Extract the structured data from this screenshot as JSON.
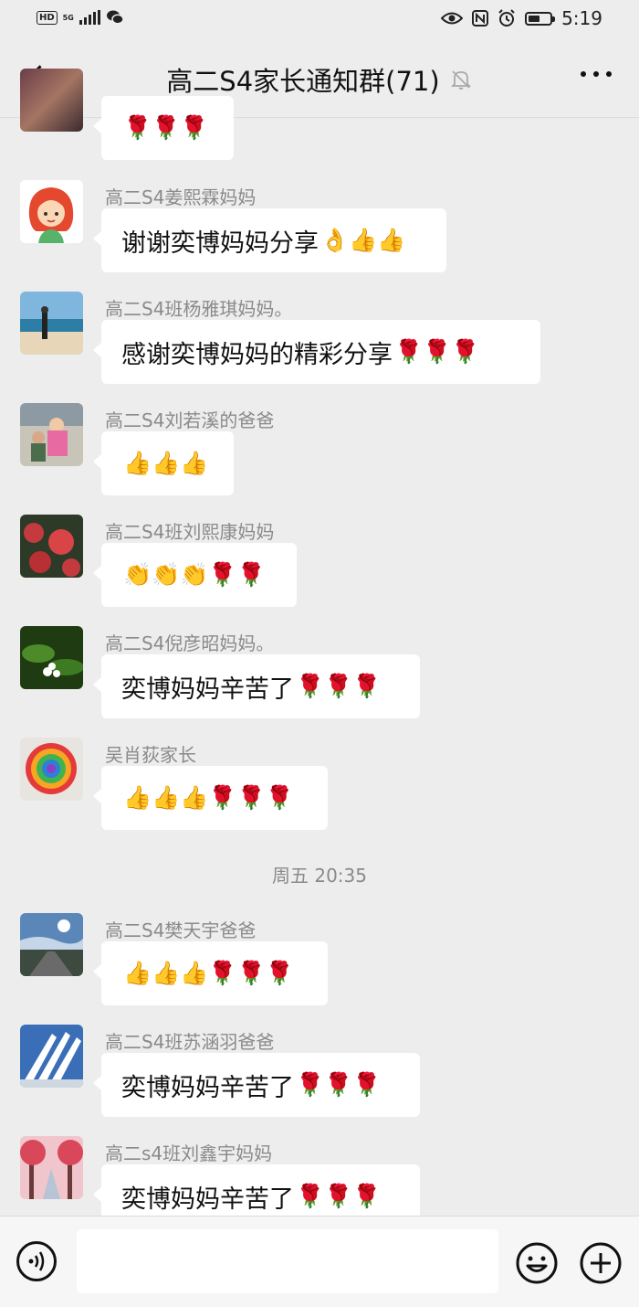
{
  "status_bar": {
    "hd": "HD",
    "network": "5G",
    "time": "5:19"
  },
  "header": {
    "title": "高二S4家长通知群(71)",
    "muted_icon": "bell-off-icon",
    "more_icon": "more-dots-icon"
  },
  "messages": [
    {
      "sender": "",
      "text": "",
      "emoji": "🌹🌹🌹"
    },
    {
      "sender": "高二S4姜熙霖妈妈",
      "text": "谢谢奕博妈妈分享",
      "emoji": "👌👍👍"
    },
    {
      "sender": "高二S4班杨雅琪妈妈。",
      "text": "感谢奕博妈妈的精彩分享",
      "emoji": "🌹🌹🌹"
    },
    {
      "sender": "高二S4刘若溪的爸爸",
      "text": "",
      "emoji": "👍👍👍"
    },
    {
      "sender": "高二S4班刘熙康妈妈",
      "text": "",
      "emoji": "👏👏👏🌹🌹"
    },
    {
      "sender": "高二S4倪彦昭妈妈。",
      "text": "奕博妈妈辛苦了",
      "emoji": "🌹🌹🌹"
    },
    {
      "sender": "吴肖荻家长",
      "text": "",
      "emoji": "👍👍👍🌹🌹🌹"
    },
    {
      "sender": "高二S4樊天宇爸爸",
      "text": "",
      "emoji": "👍👍👍🌹🌹🌹"
    },
    {
      "sender": "高二S4班苏涵羽爸爸",
      "text": "奕博妈妈辛苦了",
      "emoji": "🌹🌹🌹"
    },
    {
      "sender": "高二s4班刘鑫宇妈妈",
      "text": "奕博妈妈辛苦了",
      "emoji": "🌹🌹🌹"
    }
  ],
  "timestamp": "周五 20:35",
  "input_bar": {
    "voice_icon": "voice-icon",
    "emoji_icon": "smile-icon",
    "plus_icon": "plus-icon",
    "text_value": ""
  }
}
